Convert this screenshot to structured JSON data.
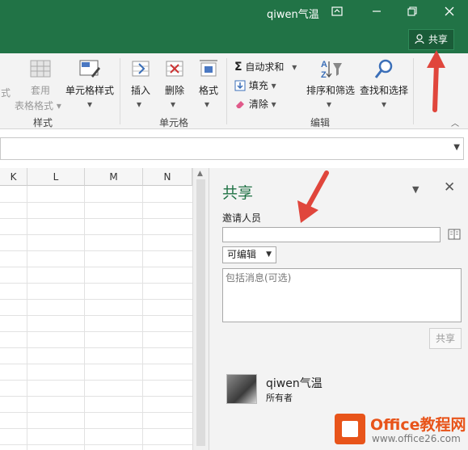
{
  "title_bar": {
    "user_name": "qiwen气温",
    "share_button": "共享",
    "icons": [
      "ribbon-display-icon",
      "minimize-icon",
      "restore-icon",
      "close-icon"
    ]
  },
  "ribbon": {
    "groups": [
      {
        "label": "样式",
        "items": [
          "式",
          "套用\n表格格式",
          "单元格样式"
        ]
      },
      {
        "label": "单元格",
        "items": [
          "插入",
          "删除",
          "格式"
        ]
      },
      {
        "label": "编辑",
        "items": [
          "自动求和",
          "填充",
          "清除",
          "排序和筛选",
          "查找和选择"
        ]
      }
    ],
    "style_partial": "式",
    "table_format_line1": "套用",
    "table_format_line2": "表格格式",
    "cell_style": "单元格样式",
    "insert": "插入",
    "delete": "删除",
    "format": "格式",
    "autosum": "自动求和",
    "fill": "填充",
    "clear": "清除",
    "sort_filter": "排序和筛选",
    "find_select": "查找和选择",
    "group_styles": "样式",
    "group_cells": "单元格",
    "group_editing": "编辑"
  },
  "grid": {
    "columns": [
      "K",
      "L",
      "M",
      "N"
    ]
  },
  "share_pane": {
    "title": "共享",
    "invite_label": "邀请人员",
    "invite_value": "",
    "permission": "可编辑",
    "message_placeholder": "包括消息(可选)",
    "share_button": "共享",
    "owner_name": "qiwen气温",
    "owner_role": "所有者"
  },
  "watermark": {
    "line1": "Office教程网",
    "line2": "www.office26.com"
  },
  "colors": {
    "brand_green": "#217346",
    "arrow_red": "#e0463c",
    "watermark_orange": "#e8541a"
  }
}
